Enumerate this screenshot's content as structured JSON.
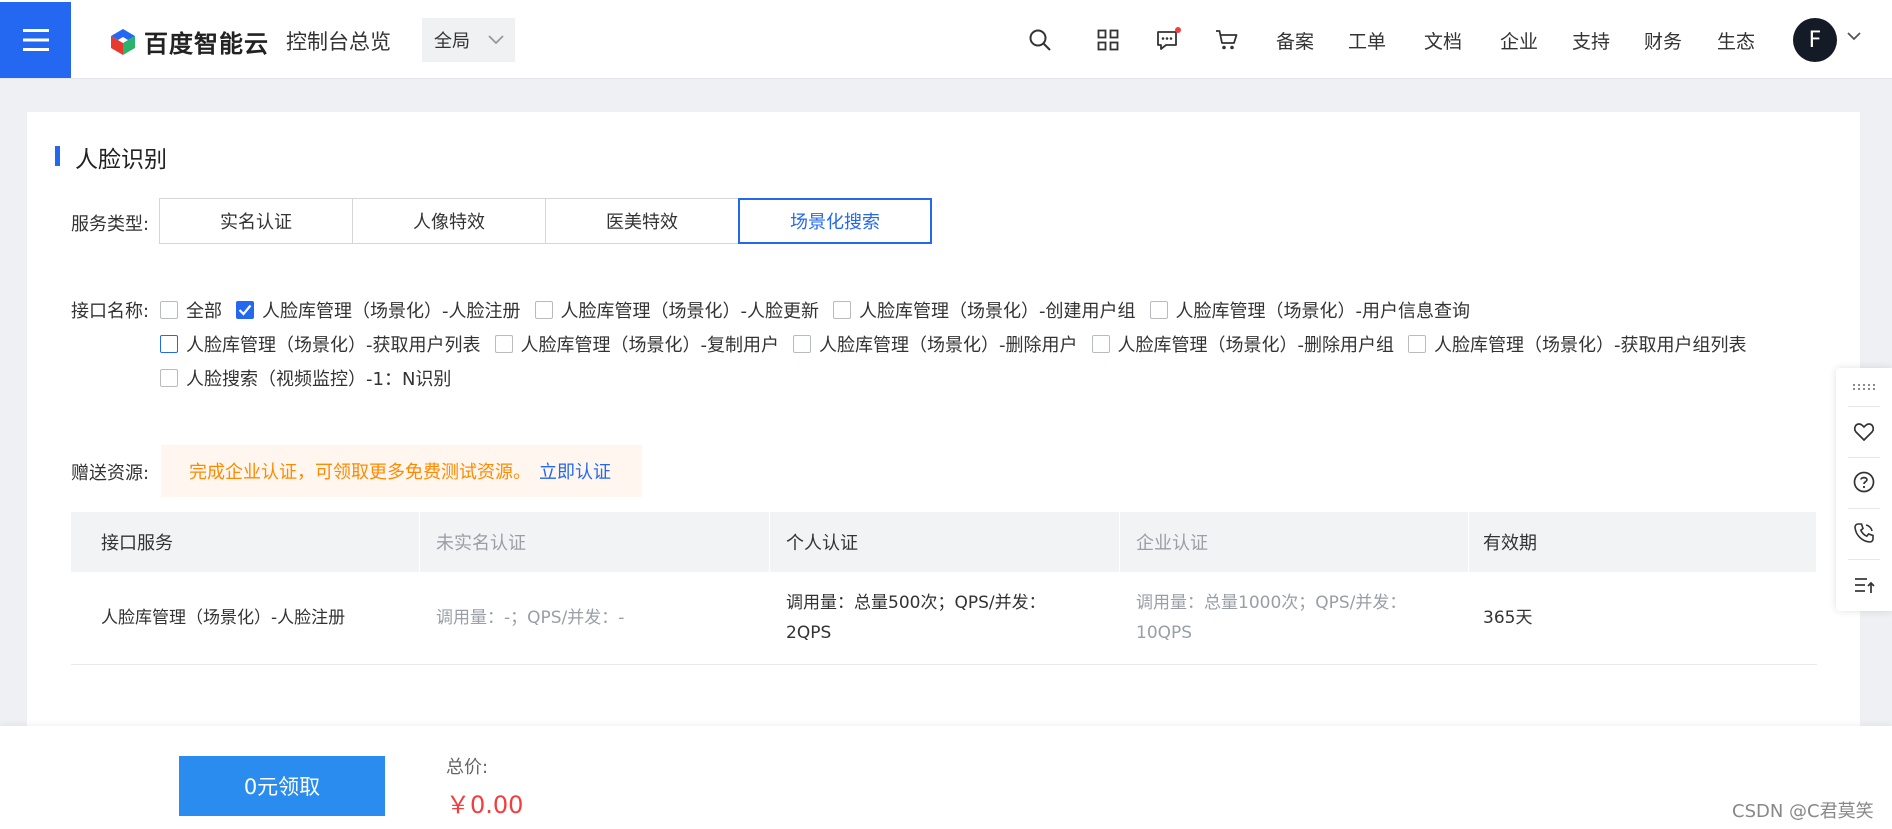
{
  "header": {
    "logo_text": "百度智能云",
    "console_title": "控制台总览",
    "region": "全局",
    "nav_links": [
      "备案",
      "工单",
      "文档",
      "企业",
      "支持",
      "财务",
      "生态"
    ],
    "avatar_letter": "F"
  },
  "section": {
    "title": "人脸识别",
    "service_type_label": "服务类型:",
    "tabs": [
      {
        "label": "实名认证",
        "active": false
      },
      {
        "label": "人像特效",
        "active": false
      },
      {
        "label": "医美特效",
        "active": false
      },
      {
        "label": "场景化搜索",
        "active": true
      }
    ],
    "interface_label": "接口名称:",
    "checkbox_rows": [
      [
        {
          "label": "全部",
          "checked": false
        },
        {
          "label": "人脸库管理（场景化）-人脸注册",
          "checked": true
        },
        {
          "label": "人脸库管理（场景化）-人脸更新",
          "checked": false
        },
        {
          "label": "人脸库管理（场景化）-创建用户组",
          "checked": false
        },
        {
          "label": "人脸库管理（场景化）-用户信息查询",
          "checked": false
        }
      ],
      [
        {
          "label": "人脸库管理（场景化）-获取用户列表",
          "checked": false
        },
        {
          "label": "人脸库管理（场景化）-复制用户",
          "checked": false
        },
        {
          "label": "人脸库管理（场景化）-删除用户",
          "checked": false
        },
        {
          "label": "人脸库管理（场景化）-删除用户组",
          "checked": false
        },
        {
          "label": "人脸库管理（场景化）-获取用户组列表",
          "checked": false
        }
      ],
      [
        {
          "label": "人脸搜索（视频监控）-1：N识别",
          "checked": false
        }
      ]
    ],
    "gift_label": "赠送资源:",
    "notice_text": "完成企业认证，可领取更多免费测试资源。",
    "notice_link": "立即认证"
  },
  "table": {
    "headers": [
      "接口服务",
      "未实名认证",
      "个人认证",
      "企业认证",
      "有效期"
    ],
    "rows": [
      {
        "service": "人脸库管理（场景化）-人脸注册",
        "unverified": "调用量：-；QPS/并发：-",
        "personal_1": "调用量：总量500次；QPS/并发：",
        "personal_2": "2QPS",
        "enterprise_1": "调用量：总量1000次；QPS/并发：",
        "enterprise_2": "10QPS",
        "validity": "365天"
      }
    ]
  },
  "footer": {
    "claim_button": "0元领取",
    "total_label": "总价:",
    "total_price": "￥0.00",
    "watermark": "CSDN @C君莫笑"
  },
  "colors": {
    "primary": "#2468f2",
    "warning": "#ff8a00",
    "price": "#f33e3e"
  },
  "icons": [
    "menu-icon",
    "search-icon",
    "grid-icon",
    "message-icon",
    "cart-icon",
    "drag-handle-icon",
    "heart-icon",
    "help-icon",
    "phone-icon",
    "back-to-top-icon"
  ]
}
